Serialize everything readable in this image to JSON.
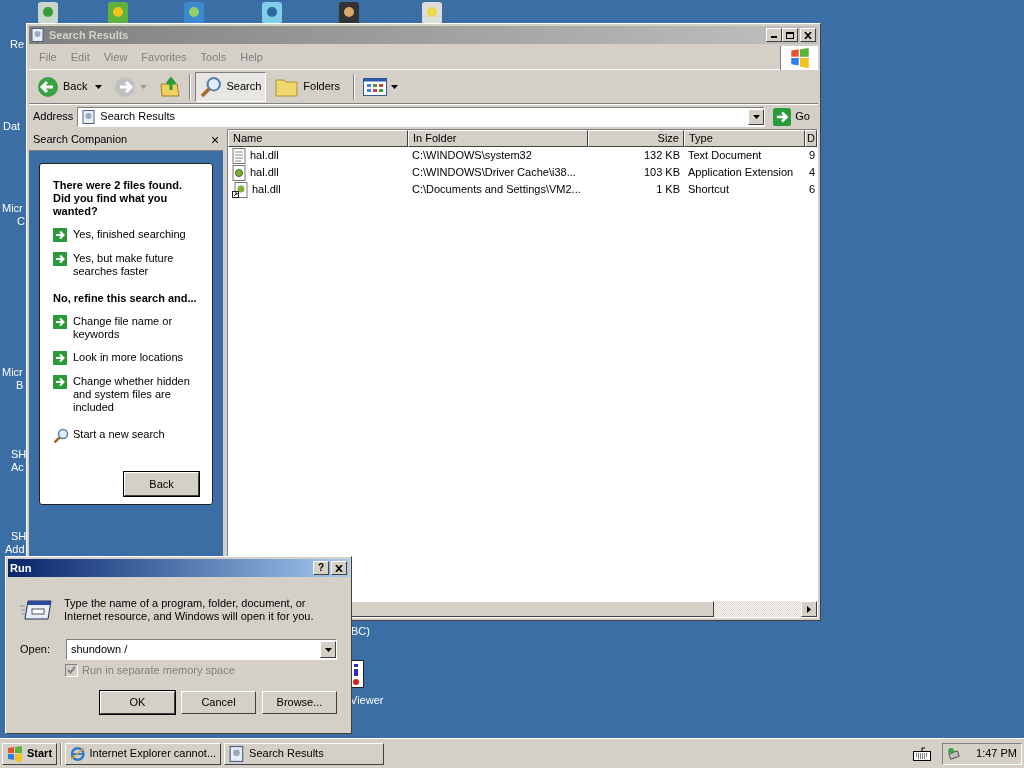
{
  "desktop": {
    "labels": [
      "Re",
      "Dat",
      "Micr",
      "C",
      "Micr",
      "B",
      "SH",
      "Ac",
      "SH",
      "Add",
      "BC)",
      "Viewer"
    ]
  },
  "explorer": {
    "title": "Search Results",
    "menu": [
      "File",
      "Edit",
      "View",
      "Favorites",
      "Tools",
      "Help"
    ],
    "toolbar": {
      "back": "Back",
      "search": {
        "label": "Search",
        "selected": true
      },
      "folders": {
        "label": "Folders",
        "selected": false
      }
    },
    "address": {
      "label": "Address",
      "value": "Search Results",
      "go": "Go"
    },
    "companion": {
      "title": "Search Companion",
      "close": "×",
      "heading": "There were 2 files found. Did you find what you wanted?",
      "items": [
        {
          "kind": "arrow",
          "text": "Yes, finished searching"
        },
        {
          "kind": "arrow",
          "text": "Yes, but make future searches faster"
        },
        {
          "kind": "heading",
          "text": "No, refine this search and..."
        },
        {
          "kind": "arrow",
          "text": "Change file name or keywords"
        },
        {
          "kind": "arrow",
          "text": "Look in more locations"
        },
        {
          "kind": "arrow",
          "text": "Change whether hidden and system files are included"
        },
        {
          "kind": "search",
          "text": "Start a new search"
        }
      ],
      "back": "Back"
    },
    "columns": [
      "Name",
      "In Folder",
      "Size",
      "Type",
      "D"
    ],
    "rows": [
      {
        "kind": "text",
        "cells": [
          "hal.dll",
          "C:\\WINDOWS\\system32",
          "132 KB",
          "Text Document",
          "9"
        ]
      },
      {
        "kind": "dll",
        "cells": [
          "hal.dll",
          "C:\\WINDOWS\\Driver Cache\\i38...",
          "103 KB",
          "Application Extension",
          "4"
        ]
      },
      {
        "kind": "shortcut",
        "cells": [
          "hal.dll",
          "C:\\Documents and Settings\\VM2...",
          "1 KB",
          "Shortcut",
          "6"
        ]
      }
    ]
  },
  "run": {
    "title": "Run",
    "help": "?",
    "description": "Type the name of a program, folder, document, or Internet resource, and Windows will open it for you.",
    "open_label": "Open:",
    "value": "shundown /",
    "checkbox": {
      "label": "Run in separate memory space",
      "checked": true,
      "disabled": true
    },
    "buttons": [
      "OK",
      "Cancel",
      "Browse..."
    ]
  },
  "taskbar": {
    "start": "Start",
    "tasks": [
      {
        "kind": "ie",
        "label": "Internet Explorer cannot...",
        "selected": false
      },
      {
        "kind": "search",
        "label": "Search Results",
        "selected": false
      }
    ],
    "clock": "1:47 PM"
  }
}
